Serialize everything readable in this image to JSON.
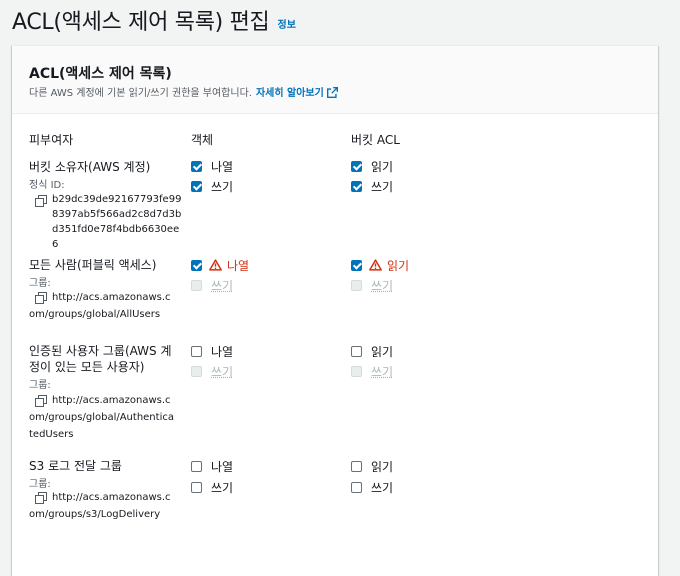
{
  "header": {
    "title": "ACL(액세스 제어 목록) 편집",
    "info": "정보"
  },
  "panel": {
    "title": "ACL(액세스 제어 목록)",
    "description": "다른 AWS 계정에 기본 읽기/쓰기 권한을 부여합니다.",
    "learn_more": "자세히 알아보기"
  },
  "columns": {
    "grantee": "피부여자",
    "objects": "객체",
    "bucket_acl": "버킷 ACL"
  },
  "rows": [
    {
      "name": "버킷 소유자(AWS 계정)",
      "id_label": "정식 ID:",
      "id_value": "b29dc39de92167793fe998397ab5f566ad2c8d7d3bd351fd0e78f4bdb6630ee6",
      "objects": [
        {
          "label": "나열",
          "checked": true,
          "disabled": false,
          "warning": false
        },
        {
          "label": "쓰기",
          "checked": true,
          "disabled": false,
          "warning": false
        }
      ],
      "bucket": [
        {
          "label": "읽기",
          "checked": true,
          "disabled": false,
          "warning": false
        },
        {
          "label": "쓰기",
          "checked": true,
          "disabled": false,
          "warning": false
        }
      ]
    },
    {
      "name": "모든 사람(퍼블릭 액세스)",
      "id_label": "그룹:",
      "id_value": "http://acs.amazonaws.com/groups/global/AllUsers",
      "objects": [
        {
          "label": "나열",
          "checked": true,
          "disabled": false,
          "warning": true
        },
        {
          "label": "쓰기",
          "checked": false,
          "disabled": true,
          "warning": false
        }
      ],
      "bucket": [
        {
          "label": "읽기",
          "checked": true,
          "disabled": false,
          "warning": true
        },
        {
          "label": "쓰기",
          "checked": false,
          "disabled": true,
          "warning": false
        }
      ]
    },
    {
      "name": "인증된 사용자 그룹(AWS 계정이 있는 모든 사용자)",
      "id_label": "그룹:",
      "id_value": "http://acs.amazonaws.com/groups/global/AuthenticatedUsers",
      "objects": [
        {
          "label": "나열",
          "checked": false,
          "disabled": false,
          "warning": false
        },
        {
          "label": "쓰기",
          "checked": false,
          "disabled": true,
          "warning": false
        }
      ],
      "bucket": [
        {
          "label": "읽기",
          "checked": false,
          "disabled": false,
          "warning": false
        },
        {
          "label": "쓰기",
          "checked": false,
          "disabled": true,
          "warning": false
        }
      ]
    },
    {
      "name": "S3 로그 전달 그룹",
      "id_label": "그룹:",
      "id_value": "http://acs.amazonaws.com/groups/s3/LogDelivery",
      "objects": [
        {
          "label": "나열",
          "checked": false,
          "disabled": false,
          "warning": false
        },
        {
          "label": "쓰기",
          "checked": false,
          "disabled": false,
          "warning": false
        }
      ],
      "bucket": [
        {
          "label": "읽기",
          "checked": false,
          "disabled": false,
          "warning": false
        },
        {
          "label": "쓰기",
          "checked": false,
          "disabled": false,
          "warning": false
        }
      ]
    }
  ],
  "colors": {
    "accent": "#0073bb",
    "warning": "#d13212",
    "text": "#16191f",
    "muted": "#545b64",
    "disabled": "#aab7b8"
  },
  "icons": {
    "copy": "copy-icon",
    "external": "external-link-icon",
    "warning": "warning-icon"
  }
}
